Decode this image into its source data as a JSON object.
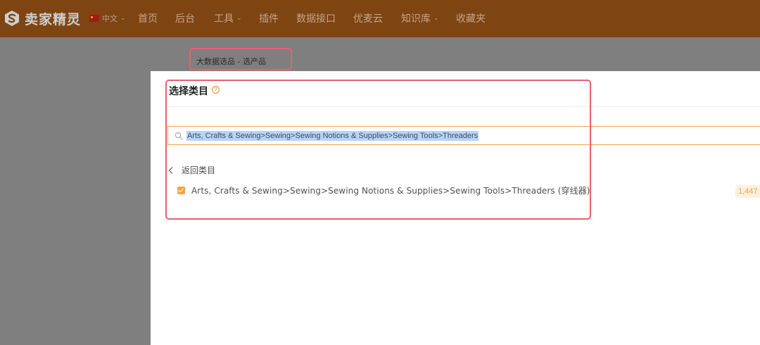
{
  "header": {
    "brand": "卖家精灵",
    "language": "中文",
    "nav": [
      {
        "label": "首页",
        "dropdown": false
      },
      {
        "label": "后台",
        "dropdown": false
      },
      {
        "label": "工具",
        "dropdown": true
      },
      {
        "label": "插件",
        "dropdown": false
      },
      {
        "label": "数据接口",
        "dropdown": false
      },
      {
        "label": "优麦云",
        "dropdown": false
      },
      {
        "label": "知识库",
        "dropdown": true
      },
      {
        "label": "收藏夹",
        "dropdown": false
      }
    ]
  },
  "page": {
    "title": "大数据选品 - 选产品"
  },
  "modal": {
    "title": "选择类目",
    "search_value": "Arts, Crafts & Sewing>Sewing>Sewing Notions & Supplies>Sewing Tools>Threaders",
    "back_label": "返回类目",
    "category": {
      "label": "Arts, Crafts & Sewing>Sewing>Sewing Notions & Supplies>Sewing Tools>Threaders (穿线器)",
      "checked": true,
      "count": "1,447"
    }
  },
  "colors": {
    "topbar": "#7e4512",
    "accent": "#f5a441",
    "highlight": "#e8606e"
  },
  "icons": [
    "logo-icon",
    "flag-icon",
    "help-icon",
    "search-icon",
    "chevron-left-icon",
    "checkbox-checked-icon"
  ]
}
